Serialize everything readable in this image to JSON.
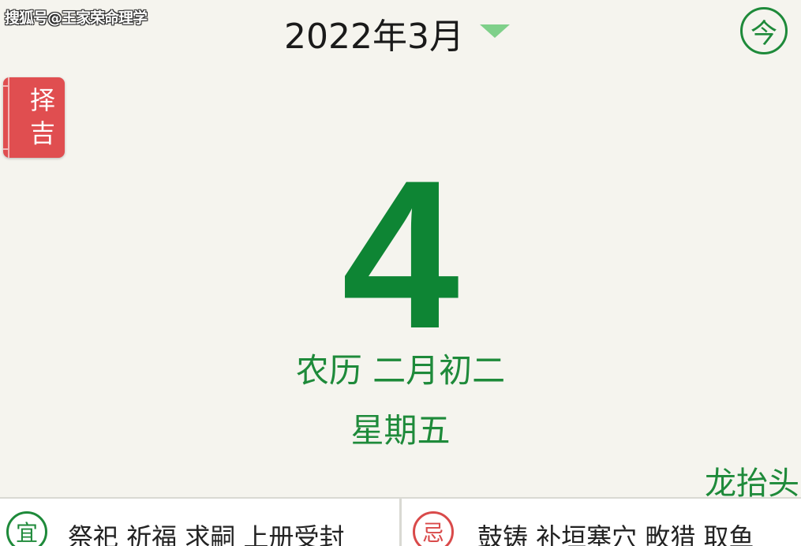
{
  "watermark": "搜狐号@王家荣命理学",
  "header": {
    "month_label": "2022年3月",
    "month_dropdown_icon": "caret-down-icon",
    "today_label": "今"
  },
  "side": {
    "zeji_label_line1": "择",
    "zeji_label_line2": "吉"
  },
  "day": {
    "number": "4",
    "lunar": "农历 二月初二",
    "weekday": "星期五",
    "festival": "龙抬头"
  },
  "almanac": {
    "yi_badge": "宜",
    "yi_text": "祭祀 祈福 求嗣 上册受封",
    "ji_badge": "忌",
    "ji_text": "鼓铸 补垣塞穴 畋猎 取鱼"
  },
  "colors": {
    "background": "#f5f4ee",
    "accent_green": "#1e8a3a",
    "day_green": "#0e8534",
    "caret_green": "#7fd08a",
    "zeji_red": "#e04e50",
    "ji_red": "#d94a4a"
  }
}
